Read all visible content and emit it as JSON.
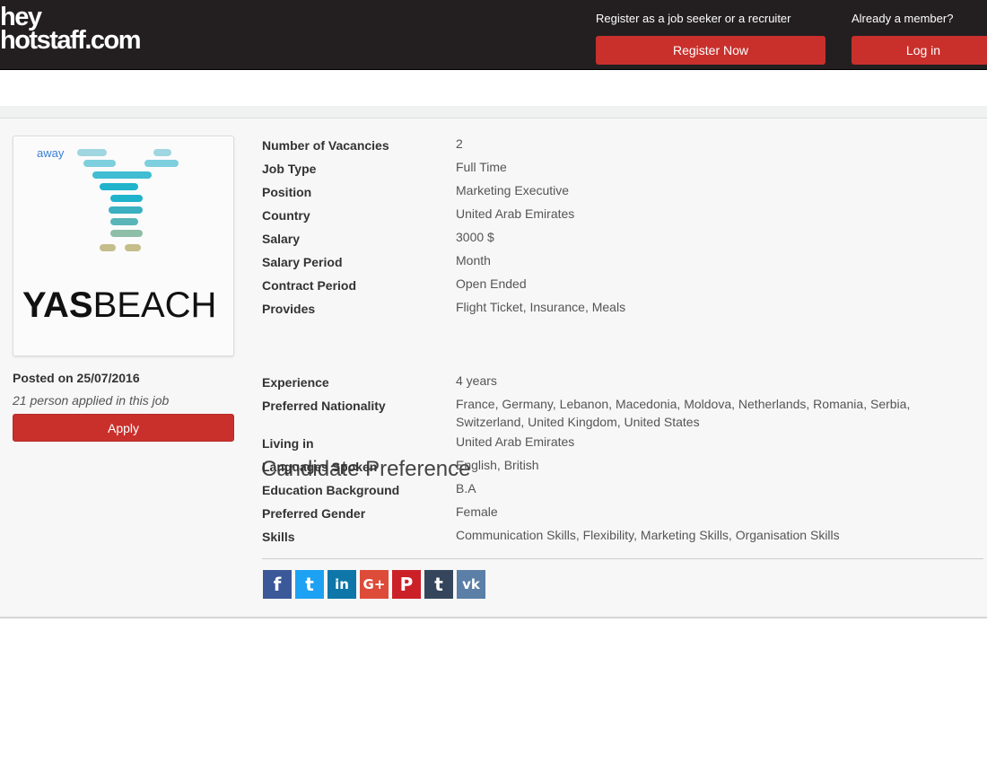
{
  "header": {
    "logo_line1": "hey",
    "logo_line2": "hotstaff.com",
    "register_prompt": "Register as a job seeker or a recruiter",
    "register_button": "Register Now",
    "member_prompt": "Already a member?",
    "login_button": "Log in"
  },
  "company": {
    "logo_alt": "away",
    "brand_bold": "YAS",
    "brand_light": "BEACH",
    "posted": "Posted on 25/07/2016",
    "applied": "21 person applied in this job",
    "apply_button": "Apply"
  },
  "details": [
    {
      "label": "Number of Vacancies",
      "value": "2"
    },
    {
      "label": "Job Type",
      "value": "Full Time"
    },
    {
      "label": "Position",
      "value": "Marketing Executive"
    },
    {
      "label": "Country",
      "value": "United Arab Emirates"
    },
    {
      "label": "Salary",
      "value": "3000 $"
    },
    {
      "label": "Salary Period",
      "value": "Month"
    },
    {
      "label": "Contract Period",
      "value": "Open Ended"
    },
    {
      "label": "Provides",
      "value": "Flight Ticket, Insurance, Meals"
    }
  ],
  "preference_title": "Candidate Preference",
  "preferences": [
    {
      "label": "Experience",
      "value": "4 years"
    },
    {
      "label": "Preferred Nationality",
      "value": "France, Germany, Lebanon, Macedonia, Moldova, Netherlands, Romania, Serbia, Switzerland, United Kingdom, United States"
    },
    {
      "label": "Living in",
      "value": "United Arab Emirates"
    },
    {
      "label": "Languages Spoken",
      "value": "English, British"
    },
    {
      "label": "Education Background",
      "value": "B.A"
    },
    {
      "label": "Preferred Gender",
      "value": "Female"
    },
    {
      "label": "Skills",
      "value": "Communication Skills, Flexibility, Marketing Skills, Organisation Skills"
    }
  ],
  "social": [
    {
      "name": "facebook",
      "glyph": "f",
      "color": "#3b5998"
    },
    {
      "name": "twitter",
      "glyph": "t",
      "color": "#1da1f2"
    },
    {
      "name": "linkedin",
      "glyph": "in",
      "color": "#0e76a8"
    },
    {
      "name": "google-plus",
      "glyph": "G+",
      "color": "#dd4b39"
    },
    {
      "name": "pinterest",
      "glyph": "P",
      "color": "#cb2027"
    },
    {
      "name": "tumblr",
      "glyph": "t",
      "color": "#35465c"
    },
    {
      "name": "vk",
      "glyph": "vk",
      "color": "#5b7fa6"
    }
  ]
}
